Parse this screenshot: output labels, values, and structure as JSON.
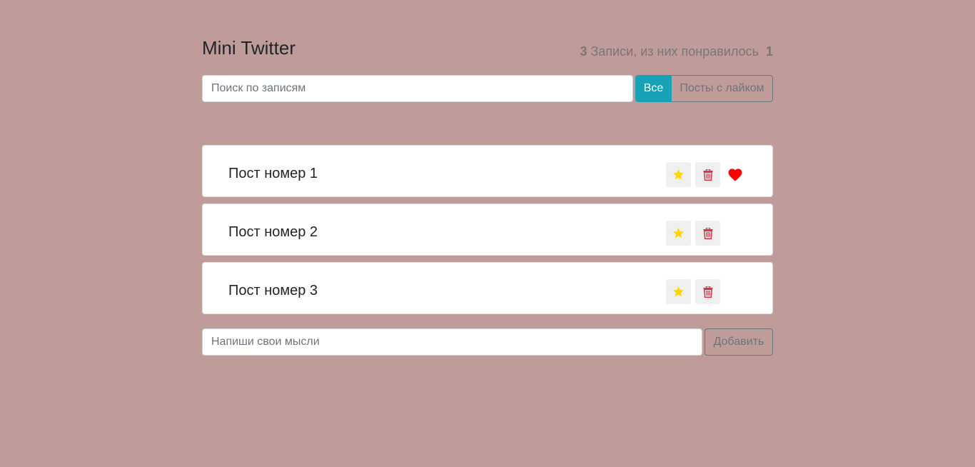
{
  "app": {
    "title": "Mini Twitter"
  },
  "stats": {
    "total": "3",
    "text": "Записи, из них понравилось",
    "liked": "1"
  },
  "search": {
    "placeholder": "Поиск по записям",
    "value": ""
  },
  "filters": {
    "all_label": "Все",
    "liked_label": "Посты с лайком",
    "active": "all"
  },
  "posts": [
    {
      "label": "Пост номер 1",
      "important": true,
      "liked": true
    },
    {
      "label": "Пост номер 2",
      "important": true,
      "liked": false
    },
    {
      "label": "Пост номер 3",
      "important": true,
      "liked": false
    }
  ],
  "add_form": {
    "placeholder": "Напиши свои мысли",
    "value": "",
    "button_label": "Добавить"
  },
  "colors": {
    "background": "#bf9c9a",
    "accent": "#17a2b8",
    "star": "#ffd700",
    "trash": "#dc3545",
    "heart": "#ff0000"
  },
  "icons": {
    "star": "star-icon",
    "trash": "trash-icon",
    "heart": "heart-icon"
  }
}
